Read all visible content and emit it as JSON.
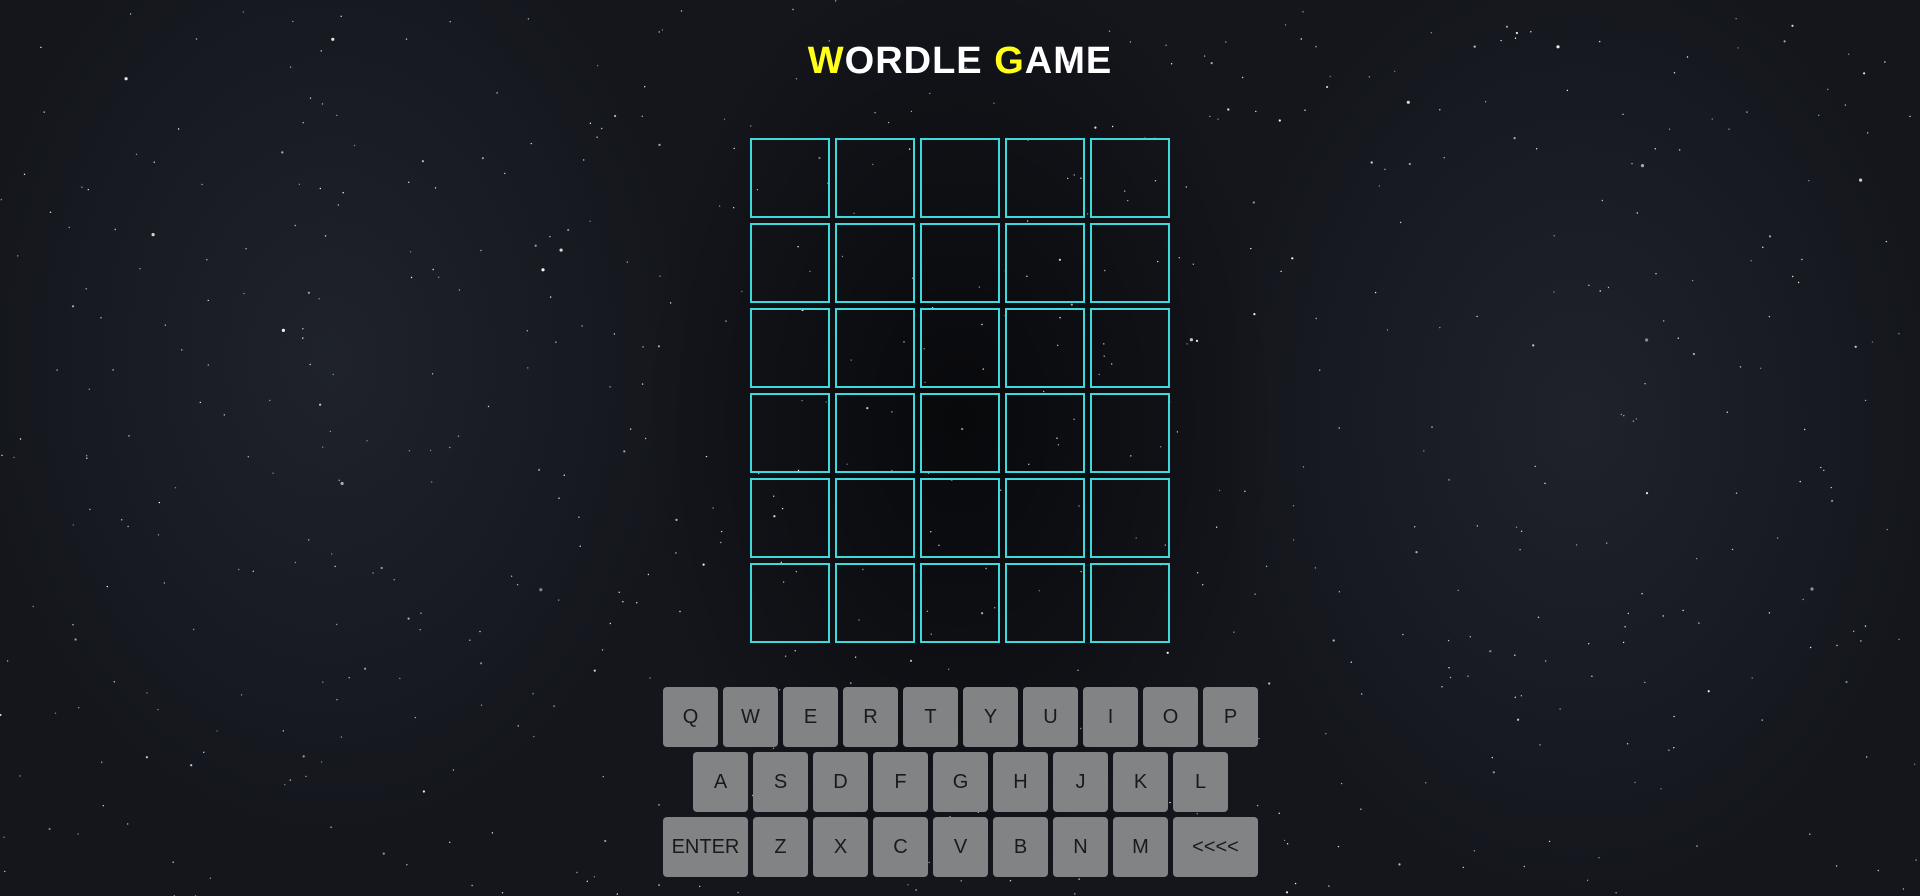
{
  "title": {
    "first_initial": "W",
    "first_rest": "ORDLE",
    "second_initial": "G",
    "second_rest": "AME"
  },
  "colors": {
    "title_accent": "#ffff1a",
    "title_text": "#ffffff",
    "tile_border": "#3dd9dc",
    "key_bg": "#818384",
    "key_text": "#1a1a1a"
  },
  "board": {
    "rows": [
      [
        "",
        "",
        "",
        "",
        ""
      ],
      [
        "",
        "",
        "",
        "",
        ""
      ],
      [
        "",
        "",
        "",
        "",
        ""
      ],
      [
        "",
        "",
        "",
        "",
        ""
      ],
      [
        "",
        "",
        "",
        "",
        ""
      ],
      [
        "",
        "",
        "",
        "",
        ""
      ]
    ]
  },
  "keyboard": {
    "row1": [
      "Q",
      "W",
      "E",
      "R",
      "T",
      "Y",
      "U",
      "I",
      "O",
      "P"
    ],
    "row2": [
      "A",
      "S",
      "D",
      "F",
      "G",
      "H",
      "J",
      "K",
      "L"
    ],
    "row3": [
      "ENTER",
      "Z",
      "X",
      "C",
      "V",
      "B",
      "N",
      "M",
      "<<<<"
    ]
  }
}
